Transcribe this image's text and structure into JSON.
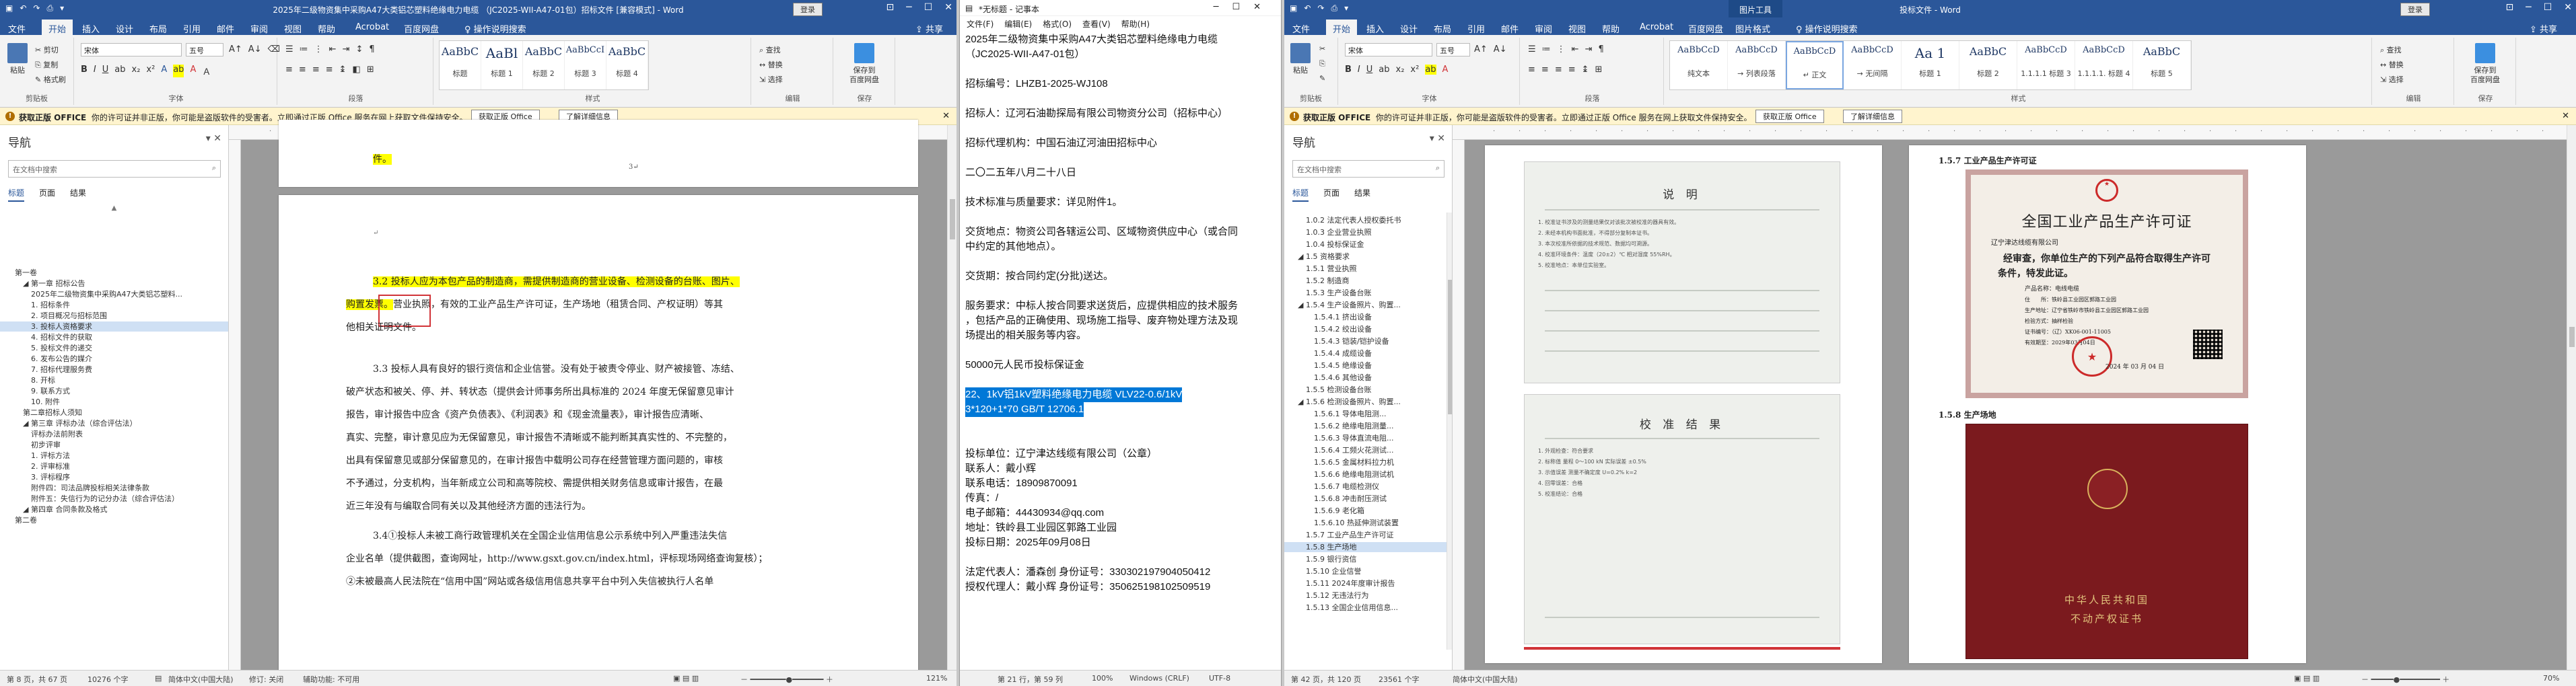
{
  "left_word": {
    "title": "2025年二级物资集中采购A47大类铝芯塑料绝缘电力电缆 （JC2025-WII-A47-01包）招标文件 [兼容模式] - Word",
    "signin": "登录",
    "qat": [
      "↶",
      "↷",
      "⎙",
      "▾"
    ],
    "tabs": [
      "文件",
      "开始",
      "插入",
      "设计",
      "布局",
      "引用",
      "邮件",
      "审阅",
      "视图",
      "帮助",
      "Acrobat",
      "百度网盘"
    ],
    "active_tab": "开始",
    "tell_me": "操作说明搜索",
    "share": "共享",
    "ribbon": {
      "paste": "粘贴",
      "cut": "✂ 剪切",
      "copy": "⎘ 复制",
      "format_painter": "✎ 格式刷",
      "clipboard": "剪贴板",
      "font_name": "宋体",
      "font_size": "五号",
      "font_group": "字体",
      "para_group": "段落",
      "styles_group": "样式",
      "styles": [
        {
          "preview": "AaBbC",
          "name": "标题"
        },
        {
          "preview": "AaBl",
          "name": "标题 1"
        },
        {
          "preview": "AaBbC",
          "name": "标题 2"
        },
        {
          "preview": "AaBbCcI",
          "name": "标题 3"
        },
        {
          "preview": "AaBbC",
          "name": "标题 4"
        }
      ],
      "find": "⌕ 查找",
      "replace": "↔ 替换",
      "select": "⇲ 选择",
      "edit_group": "编辑",
      "pdf_label": "保存到\n百度网盘",
      "pdf_group": "保存"
    },
    "msg": {
      "label": "获取正版 OFFICE",
      "text": "你的许可证并非正版，你可能是盗版软件的受害者。立即通过正版 Office 服务在网上获取文件保持安全。",
      "btn1": "获取正版 Office",
      "btn2": "了解详细信息"
    },
    "nav": {
      "title": "导航",
      "search_placeholder": "在文档中搜索",
      "tabs": [
        "标题",
        "页面",
        "结果"
      ],
      "items": [
        "第一卷",
        "◢ 第一章 招标公告",
        "2025年二级物资集中采购A47大类铝芯塑料...",
        "1. 招标条件",
        "2. 项目概况与招标范围",
        "3. 投标人资格要求",
        "4. 招标文件的获取",
        "5. 投标文件的递交",
        "6. 发布公告的媒介",
        "7. 招标代理服务费",
        "8. 开标",
        "9. 联系方式",
        "10. 附件",
        "第二章招标人须知",
        "◢ 第三章 评标办法（综合评估法）",
        "评标办法前附表",
        "初步评审",
        "1. 评标方法",
        "2. 评审标准",
        "3. 评标程序",
        "附件四：司法品牌投标相关法律条款",
        "附件五：失信行为的记分办法（综合评估法）",
        "◢ 第四章 合同条款及格式",
        "第二卷"
      ]
    },
    "doc": {
      "line_top": "件。",
      "p1_a": "3.2 投标人应为本包产品的制造商，需提供制造商的营业设备、检测设备的台账、图片、",
      "p1_b": "购置发票。",
      "p1_box": "营业执照",
      "p1_c": "，有效的工业产品生产许可证，生产场地（租赁合同、产权证明）等其",
      "p1_d": "他相关证明文件。",
      "p2_a": "3.3 投标人具有良好的银行资信和企业信誉。没有处于被责令停业、财产被接管、冻结、",
      "p2_b": "破产状态和被关、停、并、转状态（提供会计师事务所出具标准的 2024 年度无保留意见审计",
      "p2_c": "报告，审计报告中应含《资产负债表》、《利润表》和《现金流量表》，审计报告应清晰、",
      "p2_d": "真实、完整，审计意见应为无保留意见，审计报告不清晰或不能判断其真实性的、不完整的，",
      "p2_e": "出具有保留意见或部分保留意见的，在审计报告中载明公司存在经营管理方面问题的，审核",
      "p2_f": "不予通过，分支机构，当年新成立公司和高等院校、需提供相关财务信息或审计报告，在最",
      "p2_g": "近三年没有与编取合同有关以及其他经济方面的违法行为。",
      "p3_a": "3.4①投标人未被工商行政管理机关在全国企业信用信息公示系统中列入严重违法失信",
      "p3_b": "企业名单（提供截图，查询网址，http://www.gsxt.gov.cn/index.html，评标现场网络查询复核）；",
      "p3_c": "②未被最高人民法院在“信用中国”网站或各级信用信息共享平台中列入失信被执行人名单",
      "footer_mark": "3↵"
    },
    "status": {
      "page": "第 8 页，共 67 页",
      "words": "10276 个字",
      "lang": "简体中文(中国大陆)",
      "mode": "修订: 关闭",
      "access": "辅助功能: 不可用",
      "zoom": "121%"
    }
  },
  "notepad": {
    "title": "*无标题 - 记事本",
    "menu": [
      "文件(F)",
      "编辑(E)",
      "格式(O)",
      "查看(V)",
      "帮助(H)"
    ],
    "lines": [
      "2025年二级物资集中采购A47大类铝芯塑料绝缘电力电缆",
      "（JC2025-WII-A47-01包）",
      "",
      "招标编号：LHZB1-2025-WJ108",
      "",
      "招标人：辽河石油勘探局有限公司物资分公司（招标中心）",
      "",
      "招标代理机构：中国石油辽河油田招标中心",
      "",
      "二〇二五年八月二十八日",
      "",
      "技术标准与质量要求：详见附件1。",
      "",
      "交货地点：物资公司各辖运公司、区域物资供应中心（或合同",
      "中约定的其他地点）。",
      "",
      "交货期：按合同约定(分批)送达。",
      "",
      "服务要求：中标人按合同要求送货后，应提供相应的技术服务",
      "，包括产品的正确使用、现场施工指导、废弃物处理方法及现",
      "场提出的相关服务等内容。",
      "",
      "50000元人民币投标保证金",
      ""
    ],
    "selected": [
      "22、1kV铝1kV塑料绝缘电力电缆 VLV22-0.6/1kV",
      "3*120+1*70 GB/T 12706.1"
    ],
    "lines2": [
      "",
      "",
      "投标单位：辽宁津达线缆有限公司（公章）",
      "联系人：戴小辉",
      "联系电话：18909870091",
      "传真：/",
      "电子邮箱：44430934@qq.com",
      "地址：铁岭县工业园区郭路工业园",
      "投标日期：2025年09月08日",
      "",
      "法定代表人：潘森创    身份证号：330302197904050412",
      "授权代理人：戴小辉    身份证号：350625198102509519"
    ],
    "status": {
      "pos": "第 21 行，第 59 列",
      "zoom": "100%",
      "eol": "Windows (CRLF)",
      "enc": "UTF-8"
    }
  },
  "right_word": {
    "title": "投标文件 - Word",
    "tools_title": "图片工具",
    "signin": "登录",
    "qat": [
      "↶",
      "↷",
      "⎙",
      "▾"
    ],
    "tabs": [
      "文件",
      "开始",
      "插入",
      "设计",
      "布局",
      "引用",
      "邮件",
      "审阅",
      "视图",
      "帮助",
      "Acrobat",
      "百度网盘",
      "图片格式"
    ],
    "active_tab": "开始",
    "tell_me": "操作说明搜索",
    "share": "共享",
    "ribbon": {
      "paste": "粘贴",
      "cut": "✂",
      "copy": "⎘",
      "format_painter": "✎",
      "clipboard": "剪贴板",
      "font_name": "宋体",
      "font_size": "五号",
      "font_group": "字体",
      "para_group": "段落",
      "styles_group": "样式",
      "styles": [
        {
          "preview": "AaBbCcD",
          "name": "纯文本"
        },
        {
          "preview": "AaBbCcD",
          "name": "→ 列表段落"
        },
        {
          "preview": "AaBbCcD",
          "name": "↵ 正文"
        },
        {
          "preview": "AaBbCcD",
          "name": "→ 无间隔"
        },
        {
          "preview": "Aa 1",
          "name": "标题 1"
        },
        {
          "preview": "AaBbC",
          "name": "标题 2"
        },
        {
          "preview": "AaBbCcD",
          "name": "1.1.1.1 标题 3"
        },
        {
          "preview": "AaBbCcD",
          "name": "1.1.1.1. 标题 4"
        },
        {
          "preview": "AaBbC",
          "name": "标题 5"
        }
      ],
      "find": "⌕ 查找",
      "replace": "↔ 替换",
      "select": "⇲ 选择",
      "edit_group": "编辑",
      "pdf_label": "保存到\n百度网盘",
      "pdf_group": "保存"
    },
    "msg": {
      "label": "获取正版 OFFICE",
      "text": "你的许可证并非正版，你可能是盗版软件的受害者。立即通过正版 Office 服务在网上获取文件保持安全。",
      "btn1": "获取正版 Office",
      "btn2": "了解详细信息"
    },
    "nav": {
      "title": "导航",
      "search_placeholder": "在文档中搜索",
      "tabs": [
        "标题",
        "页面",
        "结果"
      ],
      "items": [
        "1.0.2 法定代表人授权委托书",
        "1.0.3 企业营业执照",
        "1.0.4 投标保证金",
        "◢ 1.5 资格要求",
        "1.5.1 营业执照",
        "1.5.2 制造商",
        "1.5.3 生产设备台账",
        "◢ 1.5.4 生产设备照片、购置...",
        "1.5.4.1 挤出设备",
        "1.5.4.2 绞出设备",
        "1.5.4.3 铠装/铠护设备",
        "1.5.4.4 成缆设备",
        "1.5.4.5 绝缘设备",
        "1.5.4.6 其他设备",
        "1.5.5 检测设备台账",
        "◢ 1.5.6 检测设备照片、购置...",
        "1.5.6.1 导体电阻测...",
        "1.5.6.2 绝缘电阻测量...",
        "1.5.6.3 导体直流电阻...",
        "1.5.6.4 工频火花测试...",
        "1.5.6.5 金属材料拉力机",
        "1.5.6.6 绝缘电阻测试机",
        "1.5.6.7 电缆检测仪",
        "1.5.6.8 冲击耐压测试",
        "1.5.6.9 老化箱",
        "1.5.6.10 热延伸测试装置",
        "1.5.7 工业产品生产许可证",
        "1.5.8 生产场地",
        "1.5.9 银行资信",
        "1.5.10 企业信誉",
        "1.5.11 2024年度审计报告",
        "1.5.12 无违法行为",
        "1.5.13 全国企业信用信息..."
      ],
      "selected_index": 27
    },
    "doc": {
      "left_scan_title": "说    明",
      "left_scan_title2": "校  准  结  果",
      "scan_lines": [
        "1. 校准证书涉及的测量结果仅对该批次被校准的器具有效。",
        "2. 未经本机构书面批准，不得部分复制本证书。",
        "3. 本次校准所依据的技术规范、数据均可溯源。",
        "4. 校准环境条件：温度（20±2）℃ 相对湿度 55%RH。",
        "5. 校准地点：本单位实验室。"
      ],
      "scan_lines2": [
        "1. 外观检查：符合要求",
        "2. 标称值 量程 0～100 kN 实际误差 ±0.5%",
        "3. 示值误差 测量不确定度 U=0.2% k=2",
        "4. 回零误差：合格",
        "5. 校准结论：合格"
      ],
      "cert_heading": "1.5.7 工业产品生产许可证",
      "cert_title": "全国工业产品生产许可证",
      "cert_company": "辽宁津达线缆有限公司",
      "cert_line1": "经审查，你单位生产的下列产品符合取得生产许可",
      "cert_line2": "条件，特发此证。",
      "cert_product": "产品名称：电线电缆",
      "cert_details": [
        "住　　所：铁岭县工业园区郭路工业园",
        "生产地址：辽宁省铁岭市铁岭县工业园区郭路工业园",
        "检验方式：抽样检验",
        "证书编号：（辽）XK06-001-11005",
        "有效期至：2029年03月04日"
      ],
      "cert_date": "2024 年 03 月 04 日",
      "site_heading": "1.5.8 生产场地",
      "book_line1": "中华人民共和国",
      "book_line2": "不动产权证书"
    },
    "status": {
      "page": "第 42 页，共 120 页",
      "words": "23561 个字",
      "lang": "简体中文(中国大陆)",
      "zoom": "70%"
    }
  },
  "colors": {
    "word_blue": "#2b579a",
    "highlight": "#ffff00",
    "selection": "#0078d7",
    "annotation_red": "#d13438"
  }
}
